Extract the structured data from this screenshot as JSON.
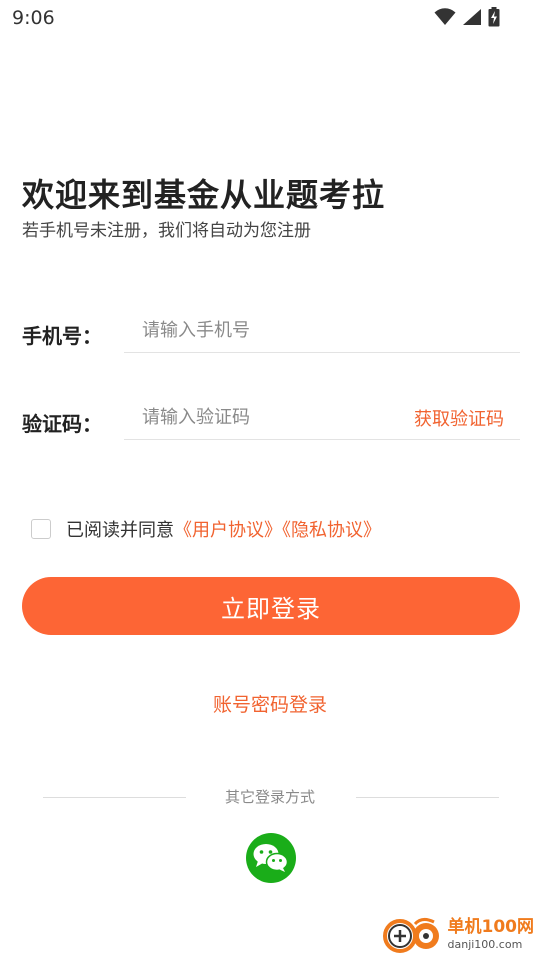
{
  "status_bar": {
    "time": "9:06",
    "icons": [
      "wifi-icon",
      "signal-icon",
      "battery-charging-icon"
    ]
  },
  "header": {
    "title": "欢迎来到基金从业题考拉",
    "subtitle": "若手机号未注册，我们将自动为您注册"
  },
  "form": {
    "phone_label": "手机号：",
    "phone_placeholder": "请输入手机号",
    "phone_value": "",
    "code_label": "验证码：",
    "code_placeholder": "请输入验证码",
    "code_value": "",
    "get_code_label": "获取验证码"
  },
  "agreement": {
    "checked": false,
    "prefix": "已阅读并同意",
    "user_agreement": "《用户协议》",
    "privacy_policy": "《隐私协议》"
  },
  "login_button": "立即登录",
  "account_login": "账号密码登录",
  "other_methods": {
    "label": "其它登录方式",
    "options": [
      "wechat-icon"
    ]
  },
  "watermark": {
    "name": "单机100网",
    "url": "danji100.com"
  },
  "colors": {
    "accent": "#fd6535",
    "link": "#f16330",
    "wechat": "#1aad19"
  }
}
